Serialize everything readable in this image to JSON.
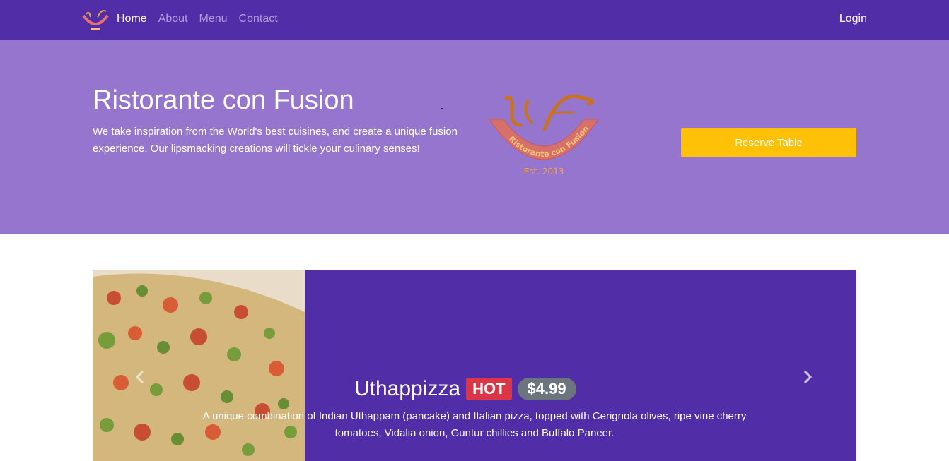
{
  "navbar": {
    "logo_icon": "restaurant-logo-icon",
    "items": [
      {
        "label": "Home",
        "active": true
      },
      {
        "label": "About",
        "active": false
      },
      {
        "label": "Menu",
        "active": false
      },
      {
        "label": "Contact",
        "active": false
      }
    ],
    "login_label": "Login",
    "bg_color": "#512da8"
  },
  "jumbotron": {
    "title": "Ristorante con Fusion",
    "text": "We take inspiration from the World's best cuisines, and create a unique fusion experience. Our lipsmacking creations will tickle your culinary senses!",
    "logo_text": "Ristorante con Fusion",
    "logo_est": "Est. 2013",
    "reserve_label": "Reserve Table",
    "bg_color": "#9575cd",
    "button_color": "#ffc107"
  },
  "carousel": {
    "dish_name": "Uthappizza",
    "badge": "HOT",
    "price": "$4.99",
    "description": "A unique combination of Indian Uthappam (pancake) and Italian pizza, topped with Cerignola olives, ripe vine cherry tomatoes, Vidalia onion, Guntur chillies and Buffalo Paneer.",
    "prev_icon": "chevron-left-icon",
    "next_icon": "chevron-right-icon",
    "badge_color": "#dc3545",
    "price_color": "#6c757d"
  }
}
